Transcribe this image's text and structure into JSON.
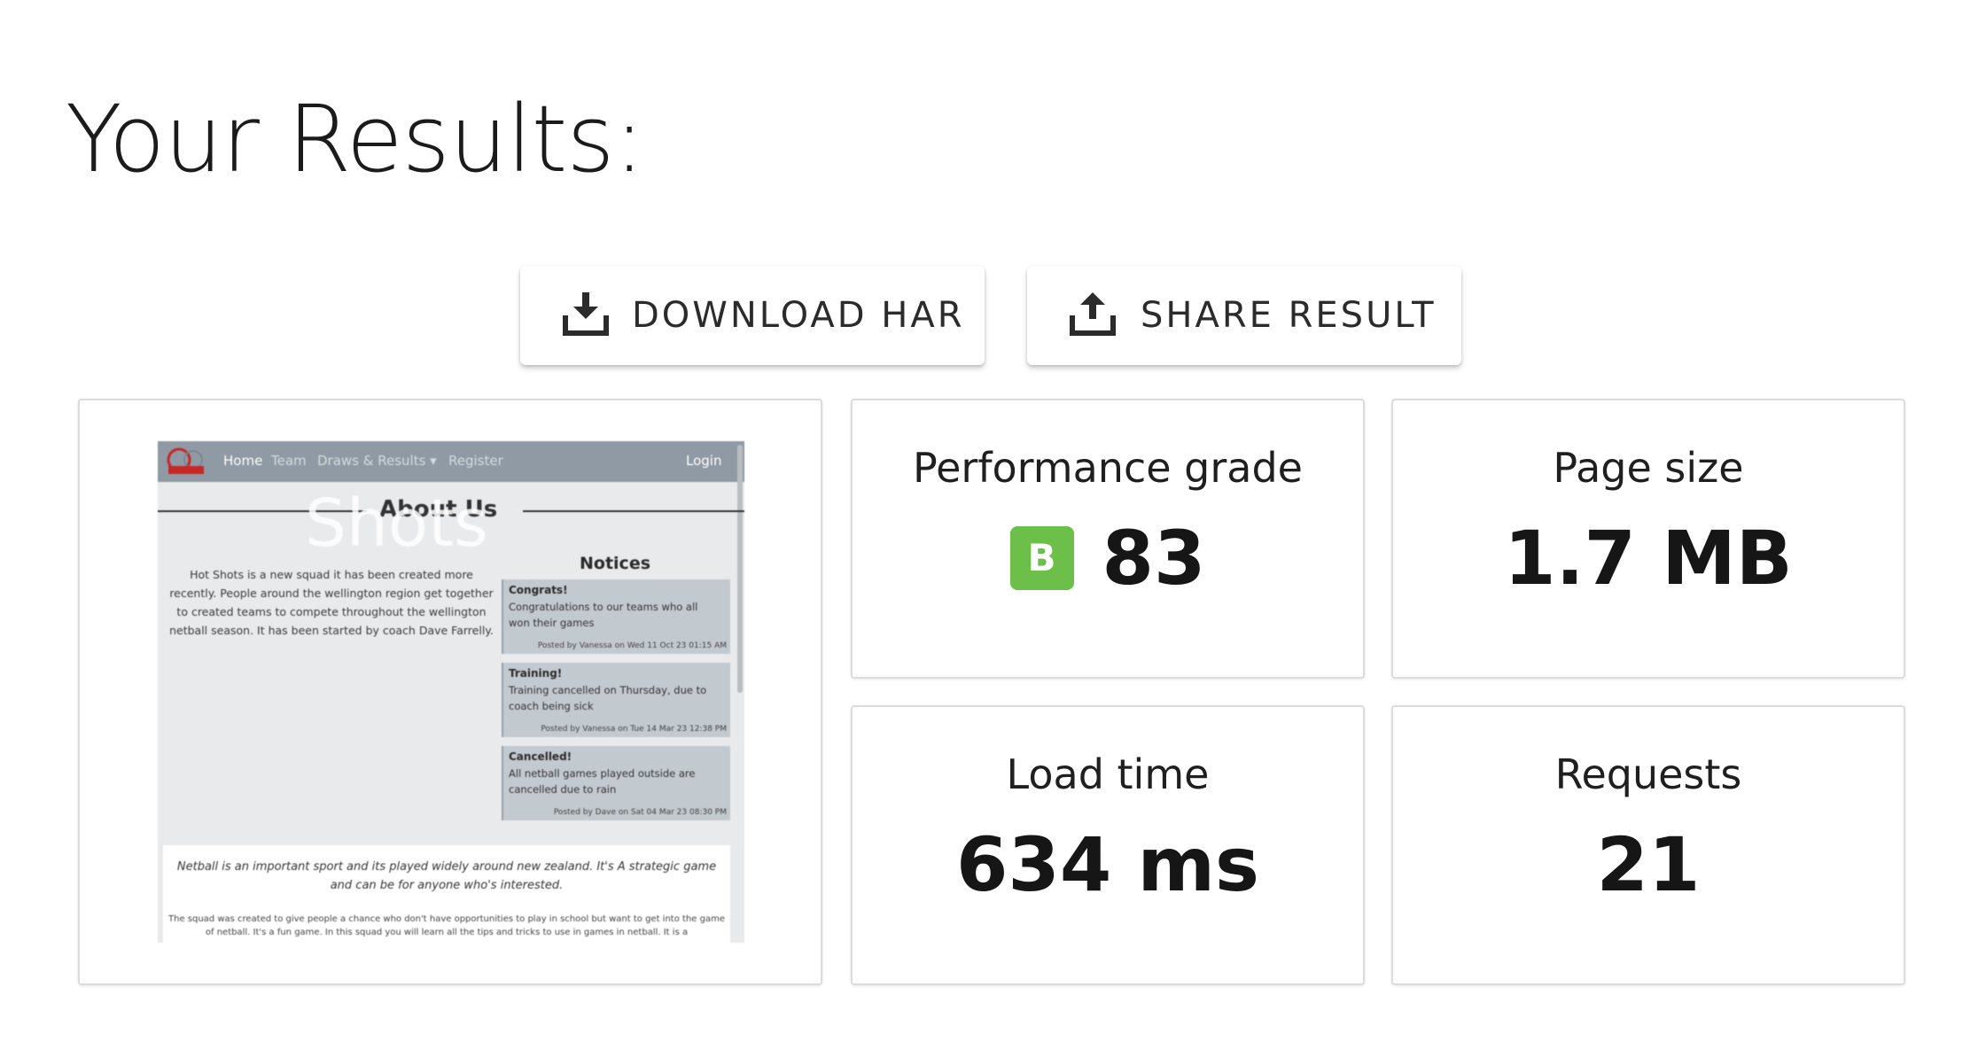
{
  "page": {
    "title": "Your Results:"
  },
  "actions": {
    "download_label": "DOWNLOAD HAR",
    "share_label": "SHARE RESULT"
  },
  "stats": {
    "performance": {
      "label": "Performance grade",
      "grade": "B",
      "score": "83",
      "grade_color": "#6cc04a"
    },
    "page_size": {
      "label": "Page size",
      "value": "1.7 MB"
    },
    "load_time": {
      "label": "Load time",
      "value": "634 ms"
    },
    "requests": {
      "label": "Requests",
      "value": "21"
    }
  },
  "screenshot": {
    "nav": {
      "home": "Home",
      "team": "Team",
      "draws": "Draws & Results ▾",
      "register": "Register",
      "login": "Login"
    },
    "watermark": "Shots",
    "heading": "About Us",
    "intro": "Hot Shots is a new squad it has been created more recently. People around the wellington region get together to created teams to compete throughout the wellington netball season. It has been started by coach Dave Farrelly.",
    "notices_title": "Notices",
    "notices": [
      {
        "title": "Congrats!",
        "body": "Congratulations to our teams who all won their games",
        "meta": "Posted by Vanessa on Wed 11 Oct 23 01:15 AM"
      },
      {
        "title": "Training!",
        "body": "Training cancelled on Thursday, due to coach being sick",
        "meta": "Posted by Vanessa on Tue 14 Mar 23 12:38 PM"
      },
      {
        "title": "Cancelled!",
        "body": "All netball games played outside are cancelled due to rain",
        "meta": "Posted by Dave on Sat 04 Mar 23 08:30 PM"
      }
    ],
    "article_lead": "Netball is an important sport and its played widely around new zealand. It's A strategic game and can be for anyone who's interested.",
    "article_body": "The squad was created to give people a chance who don't have opportunities to play in school but want to get into the game of netball. It's a fun game. In this squad you will learn all the tips and tricks to use in games in netball. It is a"
  },
  "icons": {
    "download": "download-icon",
    "share": "share-icon"
  }
}
